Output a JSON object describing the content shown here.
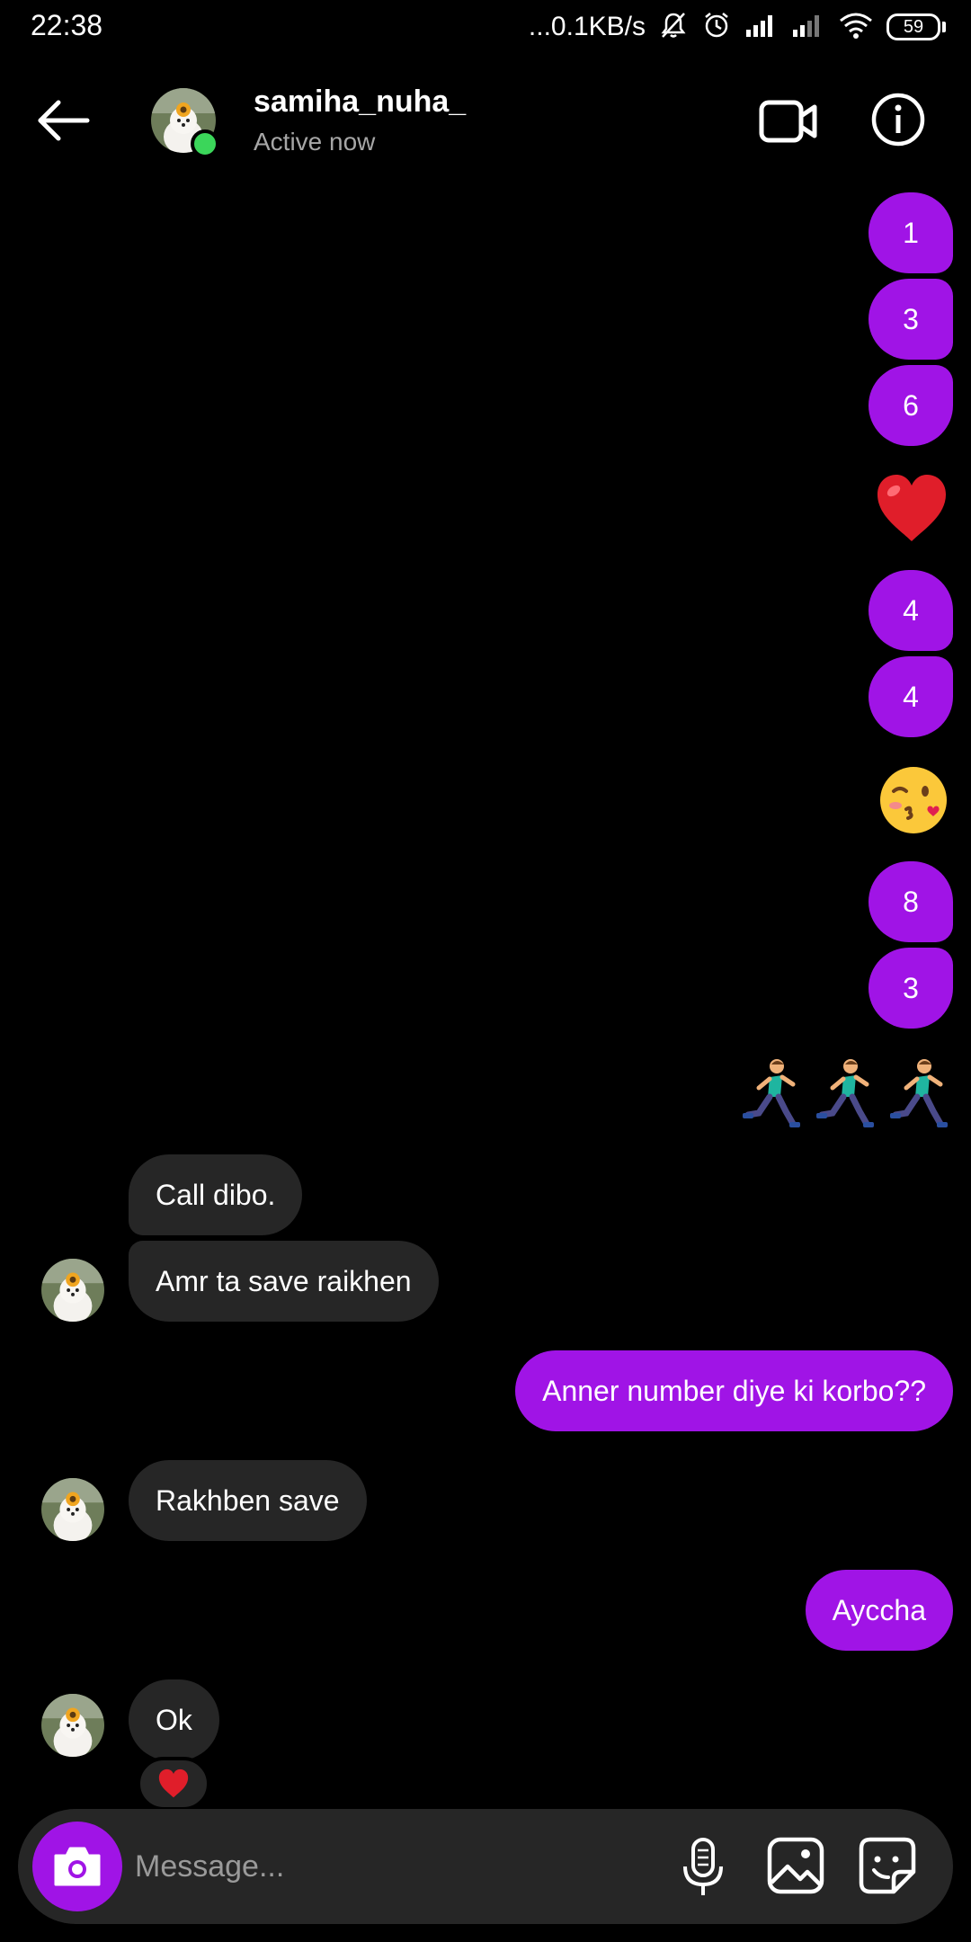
{
  "status_bar": {
    "time": "22:38",
    "network_speed": "...0.1KB/s",
    "battery": "59"
  },
  "header": {
    "username": "samiha_nuha_",
    "status": "Active now"
  },
  "colors": {
    "accent": "#a014e6",
    "incoming_bubble": "#262626",
    "online": "#3bd65a"
  },
  "messages": {
    "num_1": "1",
    "num_2": "3",
    "num_3": "6",
    "num_4": "4",
    "num_5": "4",
    "num_6": "8",
    "num_7": "3",
    "in_1": "Call dibo.",
    "in_2": "Amr ta save raikhen",
    "out_1": "Anner number diye ki korbo??",
    "in_3": "Rakhben save",
    "out_2": "Ayccha",
    "in_4": "Ok"
  },
  "composer": {
    "placeholder": "Message..."
  },
  "icons": [
    "back-arrow-icon",
    "video-call-icon",
    "info-icon",
    "heart-emoji",
    "kiss-emoji",
    "runner-emoji",
    "camera-icon",
    "microphone-icon",
    "gallery-icon",
    "sticker-icon"
  ]
}
